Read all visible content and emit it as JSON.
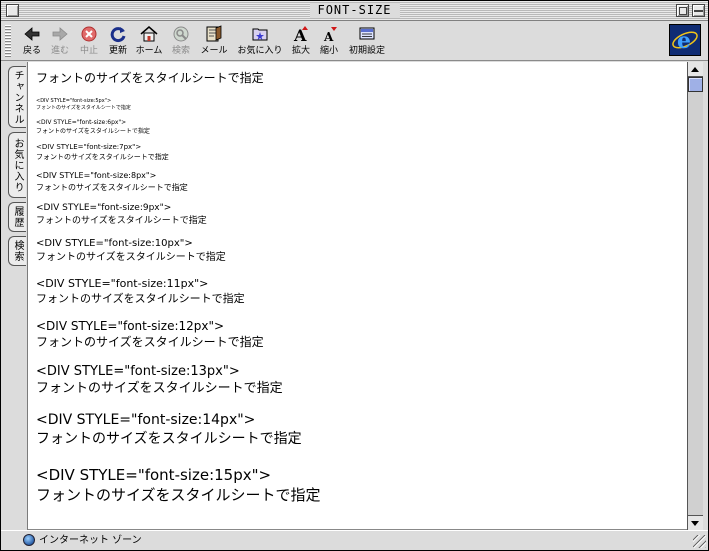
{
  "window": {
    "title": "FONT-SIZE"
  },
  "toolbar": {
    "buttons": [
      {
        "label": "戻る",
        "icon": "back-arrow-icon",
        "enabled": true
      },
      {
        "label": "進む",
        "icon": "forward-arrow-icon",
        "enabled": false
      },
      {
        "label": "中止",
        "icon": "stop-icon",
        "enabled": false
      },
      {
        "label": "更新",
        "icon": "refresh-icon",
        "enabled": true
      },
      {
        "label": "ホーム",
        "icon": "home-icon",
        "enabled": true
      },
      {
        "label": "検索",
        "icon": "search-icon",
        "enabled": false
      },
      {
        "label": "メール",
        "icon": "mail-icon",
        "enabled": true
      },
      {
        "label": "お気に入り",
        "icon": "favorites-icon",
        "enabled": true
      },
      {
        "label": "拡大",
        "icon": "text-larger-icon",
        "enabled": true
      },
      {
        "label": "縮小",
        "icon": "text-smaller-icon",
        "enabled": true
      },
      {
        "label": "初期設定",
        "icon": "preferences-icon",
        "enabled": true
      }
    ],
    "brand_icon": "internet-explorer-logo-icon"
  },
  "side_tabs": [
    {
      "label": "チャンネル"
    },
    {
      "label": "お気に入り"
    },
    {
      "label": "履歴"
    },
    {
      "label": "検索"
    }
  ],
  "page": {
    "heading": "フォントのサイズをスタイルシートで指定",
    "entries": [
      {
        "code": "<DIV STYLE=\"font-size:5px\">",
        "text": "フォントのサイズをスタイルシートで指定"
      },
      {
        "code": "<DIV STYLE=\"font-size:6px\">",
        "text": "フォントのサイズをスタイルシートで指定"
      },
      {
        "code": "<DIV STYLE=\"font-size:7px\">",
        "text": "フォントのサイズをスタイルシートで指定"
      },
      {
        "code": "<DIV STYLE=\"font-size:8px\">",
        "text": "フォントのサイズをスタイルシートで指定"
      },
      {
        "code": "<DIV STYLE=\"font-size:9px\">",
        "text": "フォントのサイズをスタイルシートで指定"
      },
      {
        "code": "<DIV STYLE=\"font-size:10px\">",
        "text": "フォントのサイズをスタイルシートで指定"
      },
      {
        "code": "<DIV STYLE=\"font-size:11px\">",
        "text": "フォントのサイズをスタイルシートで指定"
      },
      {
        "code": "<DIV STYLE=\"font-size:12px\">",
        "text": "フォントのサイズをスタイルシートで指定"
      },
      {
        "code": "<DIV STYLE=\"font-size:13px\">",
        "text": "フォントのサイズをスタイルシートで指定"
      },
      {
        "code": "<DIV STYLE=\"font-size:14px\">",
        "text": "フォントのサイズをスタイルシートで指定"
      },
      {
        "code": "<DIV STYLE=\"font-size:15px\">",
        "text": "フォントのサイズをスタイルシートで指定"
      }
    ]
  },
  "status": {
    "zone": "インターネット ゾーン",
    "zone_icon": "globe-icon"
  },
  "colors": {
    "scroll_thumb": "#9fb0e6",
    "ie_logo_bg": "#0f2c74",
    "stop_red": "#d01818"
  }
}
